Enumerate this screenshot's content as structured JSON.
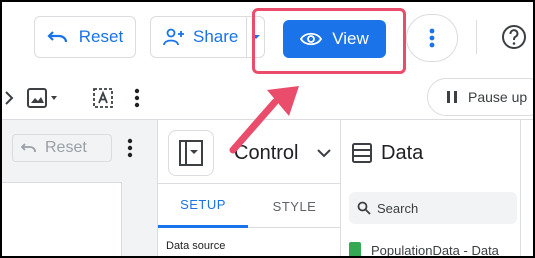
{
  "toolbar": {
    "reset_label": "Reset",
    "share_label": "Share",
    "view_label": "View",
    "pause_label": "Pause up"
  },
  "canvas": {
    "reset_label": "Reset"
  },
  "control_panel": {
    "title": "Control",
    "tabs": [
      {
        "label": "SETUP",
        "active": true
      },
      {
        "label": "STYLE",
        "active": false
      }
    ],
    "data_source_label": "Data source"
  },
  "data_panel": {
    "title": "Data",
    "search_placeholder": "Search",
    "source_item": "PopulationData - Data"
  },
  "colors": {
    "accent": "#1a73e8",
    "highlight": "#ea4c6b",
    "sheet_green": "#34a853"
  },
  "icons": {
    "reset": "undo-arrow-icon",
    "share": "add-person-icon",
    "view": "eye-icon",
    "more": "vertical-dots-icon",
    "help": "question-circle-icon",
    "pause": "pause-icon"
  }
}
